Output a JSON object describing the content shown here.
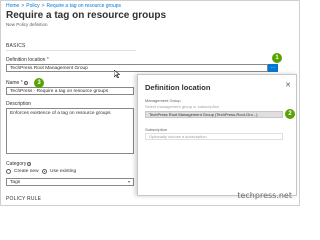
{
  "breadcrumb": {
    "home": "Home",
    "policy": "Policy",
    "current": "Require a tag on resource groups",
    "separator": ">"
  },
  "page": {
    "title": "Require a tag on resource groups",
    "subtitle": "New Policy definition"
  },
  "sections": {
    "basics": "BASICS",
    "policy_rule": "POLICY RULE"
  },
  "fields": {
    "definition_location_label": "Definition location",
    "definition_location_value": "TechPress Root Management Group",
    "ellipsis_label": "...",
    "name_label": "Name",
    "name_value": "TechPress - Require a tag on resource groups",
    "description_label": "Description",
    "description_value": "Enforces existence of a tag on resource groups",
    "category_label": "Category",
    "category_create_new": "Create new",
    "category_use_existing": "Use existing",
    "category_value": "Tags"
  },
  "markers": {
    "one": "1",
    "two": "2",
    "three": "3"
  },
  "panel": {
    "title": "Definition location",
    "close": "✕",
    "management_group_label": "Management Group",
    "management_group_hint": "Select management group or subscription",
    "selected_group": "TechPress Root Management Group (TechPress-Root-Gro...)",
    "subscription_label": "Subscription",
    "subscription_placeholder": "Optionally choose a subscription"
  },
  "watermark": "techpress.net",
  "colors": {
    "link": "#0078d4",
    "accent_button": "#0078d4",
    "step_marker": "#57a300",
    "required": "#a4262c"
  }
}
